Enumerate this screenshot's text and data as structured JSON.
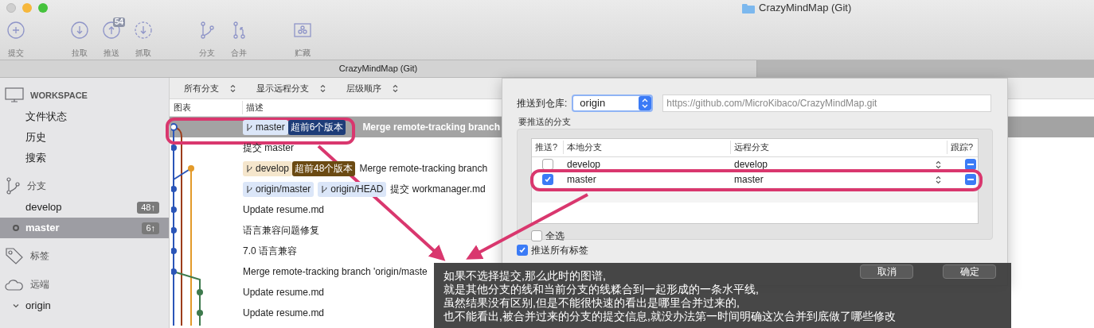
{
  "window": {
    "title": "CrazyMindMap (Git)"
  },
  "toolbar": [
    [
      {
        "kind": "commit",
        "label": "提交"
      }
    ],
    [
      {
        "kind": "pull",
        "label": "拉取"
      },
      {
        "kind": "push",
        "label": "推送",
        "badge": "54"
      },
      {
        "kind": "fetch",
        "label": "抓取"
      }
    ],
    [
      {
        "kind": "branch",
        "label": "分支"
      },
      {
        "kind": "merge",
        "label": "合并"
      }
    ],
    [
      {
        "kind": "stash",
        "label": "贮藏"
      }
    ]
  ],
  "tab": {
    "title": "CrazyMindMap (Git)"
  },
  "sidebar": [
    {
      "kind": "workspace",
      "title": "WORKSPACE",
      "items": [
        {
          "label": "文件状态",
          "selected": false
        },
        {
          "label": "历史",
          "selected": false
        },
        {
          "label": "搜索",
          "selected": false
        }
      ]
    },
    {
      "kind": "branches",
      "title": "分支",
      "items": [
        {
          "label": "develop",
          "badge": "48↑",
          "selected": false,
          "current": false
        },
        {
          "label": "master",
          "badge": "6↑",
          "selected": true,
          "current": true
        }
      ]
    },
    {
      "kind": "tags",
      "title": "标签"
    },
    {
      "kind": "remotes",
      "title": "远端",
      "items": [
        {
          "label": "origin",
          "expanded": true
        }
      ]
    }
  ],
  "filters": [
    {
      "label": "所有分支"
    },
    {
      "label": "显示远程分支"
    },
    {
      "label": "层级顺序"
    }
  ],
  "history": {
    "columns": [
      "图表",
      "描述"
    ],
    "rows": [
      {
        "selected": true,
        "refs": [
          {
            "label": "master",
            "color": "#dbe6f8"
          }
        ],
        "ahead": {
          "text": "超前6个版本",
          "color": "#1d3c78"
        },
        "message": "Merge remote-tracking branch"
      },
      {
        "selected": false,
        "message": "提交 master"
      },
      {
        "selected": false,
        "refs": [
          {
            "label": "develop",
            "color": "#f5e6cc"
          }
        ],
        "ahead": {
          "text": "超前48个版本",
          "color": "#6b4a12"
        },
        "message": "Merge remote-tracking branch"
      },
      {
        "selected": false,
        "refs": [
          {
            "label": "origin/master",
            "color": "#dbe6f8"
          },
          {
            "label": "origin/HEAD",
            "color": "#dbe6f8"
          }
        ],
        "message": "提交 workmanager.md"
      },
      {
        "selected": false,
        "message": "Update resume.md"
      },
      {
        "selected": false,
        "message": "语言兼容问题修复"
      },
      {
        "selected": false,
        "message": "7.0 语言兼容"
      },
      {
        "selected": false,
        "message": "Merge remote-tracking branch 'origin/maste"
      },
      {
        "selected": false,
        "message": "Update resume.md"
      },
      {
        "selected": false,
        "message": "Update resume.md"
      }
    ]
  },
  "push_dialog": {
    "repo_label": "推送到仓库:",
    "repo": "origin",
    "url": "https://github.com/MicroKibaco/CrazyMindMap.git",
    "group_label": "要推送的分支",
    "columns": [
      "推送?",
      "本地分支",
      "远程分支",
      "跟踪?"
    ],
    "rows": [
      {
        "checked": false,
        "local": "develop",
        "remote": "develop",
        "track": true
      },
      {
        "checked": true,
        "local": "master",
        "remote": "master",
        "track": true
      }
    ],
    "select_all": {
      "label": "全选",
      "checked": false
    },
    "push_tags": {
      "label": "推送所有标签",
      "checked": true
    },
    "buttons": [
      "取消",
      "确定"
    ]
  },
  "caption": [
    "如果不选择提交,那么此时的图谱,",
    "就是其他分支的线和当前分支的线糅合到一起形成的一条水平线,",
    "虽然结果没有区别,但是不能很快速的看出是哪里合并过来的,",
    "也不能看出,被合并过来的分支的提交信息,就没办法第一时间明确这次合并到底做了哪些修改"
  ]
}
